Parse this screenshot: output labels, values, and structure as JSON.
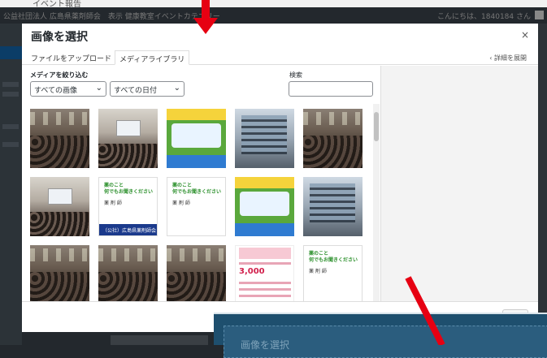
{
  "background": {
    "partial_label": "イベント報告",
    "admin_bar_left": "公益社団法人 広島県薬剤師会　表示 健康教室イベントカテゴリー",
    "admin_bar_right": "こんにちは、1840184 さん"
  },
  "modal": {
    "title": "画像を選択",
    "close_icon": "×",
    "tabs": [
      {
        "label": "ファイルをアップロード",
        "active": false
      },
      {
        "label": "メディアライブラリ",
        "active": true
      }
    ],
    "details_link": "‹ 詳細を展開"
  },
  "filters": {
    "label": "メディアを絞り込む",
    "type_select": "すべての画像",
    "date_select": "すべての日付",
    "search_label": "検索",
    "search_value": ""
  },
  "thumbnails": [
    {
      "kind": "crowd"
    },
    {
      "kind": "room"
    },
    {
      "kind": "poster"
    },
    {
      "kind": "building"
    },
    {
      "kind": "crowd"
    },
    {
      "kind": "room"
    },
    {
      "kind": "slide",
      "line1": "薬のこと\n何でもお聞きください",
      "line2": "薬 剤 師",
      "footer": "（公社）広島県薬剤師会"
    },
    {
      "kind": "slide",
      "line1": "薬のこと\n何でもお聞きください",
      "line2": "薬 剤 師",
      "footer": ""
    },
    {
      "kind": "poster"
    },
    {
      "kind": "building"
    },
    {
      "kind": "crowd"
    },
    {
      "kind": "crowd"
    },
    {
      "kind": "crowd"
    },
    {
      "kind": "flyer",
      "big": "3,000"
    },
    {
      "kind": "slide",
      "line1": "薬のこと\n何でもお聞きください",
      "line2": "薬 剤 師",
      "footer": ""
    }
  ],
  "overlay": {
    "title": "画像を選択"
  },
  "colors": {
    "arrow": "#e60012"
  }
}
